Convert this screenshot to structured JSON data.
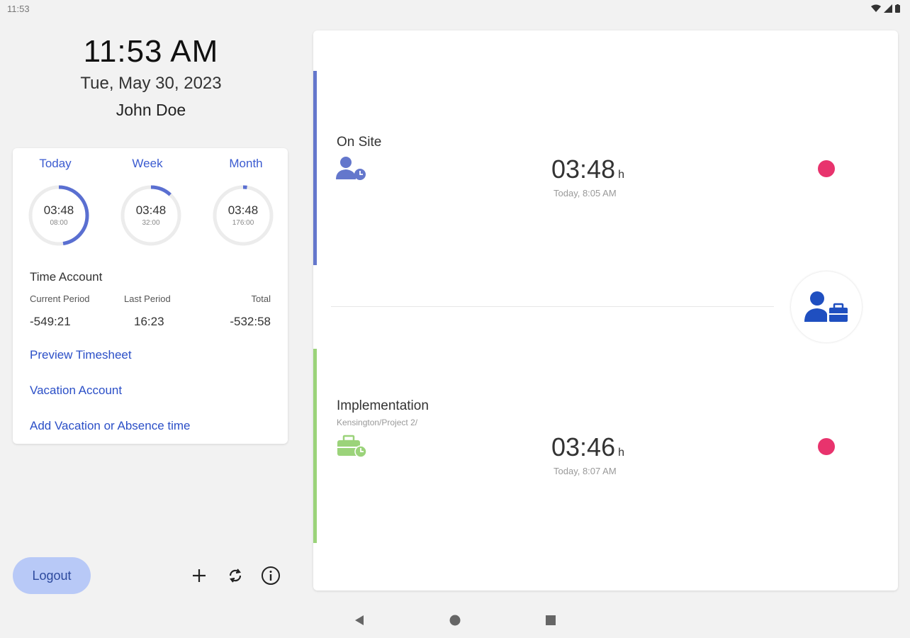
{
  "status_bar": {
    "time": "11:53"
  },
  "header": {
    "clock": "11:53 AM",
    "date": "Tue, May 30, 2023",
    "user": "John Doe"
  },
  "summary": {
    "tabs": [
      "Today",
      "Week",
      "Month"
    ],
    "rings": [
      {
        "value": "03:48",
        "target": "08:00",
        "progress": 0.475
      },
      {
        "value": "03:48",
        "target": "32:00",
        "progress": 0.119
      },
      {
        "value": "03:48",
        "target": "176:00",
        "progress": 0.022
      }
    ],
    "accent_color": "#5a6fd1"
  },
  "time_account": {
    "title": "Time Account",
    "labels": [
      "Current Period",
      "Last Period",
      "Total"
    ],
    "values": [
      "-549:21",
      "16:23",
      "-532:58"
    ]
  },
  "links": {
    "preview": "Preview Timesheet",
    "vacation": "Vacation Account",
    "add": "Add Vacation or Absence time"
  },
  "footer": {
    "logout": "Logout",
    "icons": [
      "plus-icon",
      "sync-icon",
      "info-icon"
    ]
  },
  "entries": [
    {
      "title": "On Site",
      "subtitle": "",
      "time": "03:48",
      "unit": "h",
      "when": "Today, 8:05 AM",
      "bar_color": "#6477cc",
      "icon": "person-clock-icon",
      "status_color": "#e8336d"
    },
    {
      "title": "Implementation",
      "subtitle": "Kensington/Project 2/",
      "time": "03:46",
      "unit": "h",
      "when": "Today, 8:07 AM",
      "bar_color": "#9bd37a",
      "icon": "briefcase-clock-icon",
      "status_color": "#e8336d"
    }
  ],
  "fab": {
    "icon": "person-briefcase-icon",
    "color": "#1f4fc0"
  },
  "nav": {
    "icons": [
      "back-icon",
      "home-icon",
      "recents-icon"
    ]
  }
}
